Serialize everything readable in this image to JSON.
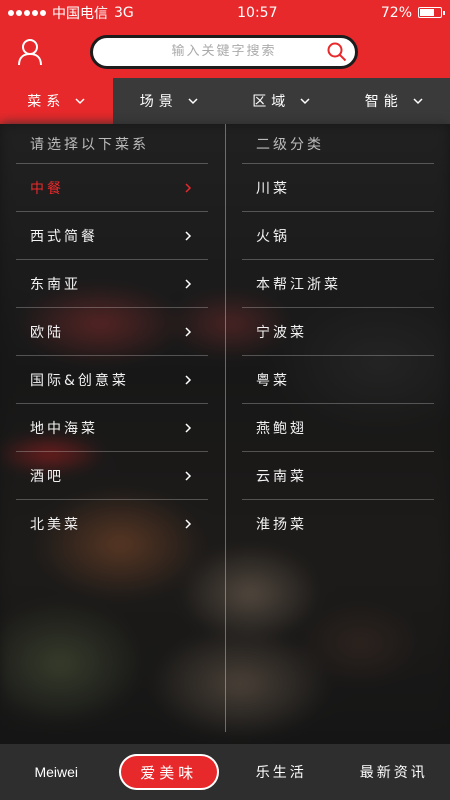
{
  "status_bar": {
    "carrier": "中国电信",
    "network": "3G",
    "time": "10:57",
    "battery": "72%",
    "battery_level": 0.72
  },
  "header": {
    "search_placeholder": "输入关键字搜索"
  },
  "tabs": [
    {
      "label": "菜系",
      "active": true
    },
    {
      "label": "场景",
      "active": false
    },
    {
      "label": "区域",
      "active": false
    },
    {
      "label": "智能",
      "active": false
    }
  ],
  "left_column": {
    "header": "请选择以下菜系",
    "items": [
      "中餐",
      "西式简餐",
      "东南亚",
      "欧陆",
      "国际&创意菜",
      "地中海菜",
      "酒吧",
      "北美菜"
    ],
    "active_index": 0
  },
  "right_column": {
    "header": "二级分类",
    "items": [
      "川菜",
      "火锅",
      "本帮江浙菜",
      "宁波菜",
      "粤菜",
      "燕鲍翅",
      "云南菜",
      "淮扬菜"
    ]
  },
  "bottom_nav": {
    "items": [
      "Meiwei",
      "爱美味",
      "乐生活",
      "最新资讯"
    ]
  },
  "colors": {
    "brand_red": "#e8292b",
    "tab_bg": "#3a3a3a",
    "nav_bg": "#2e2e2e"
  }
}
